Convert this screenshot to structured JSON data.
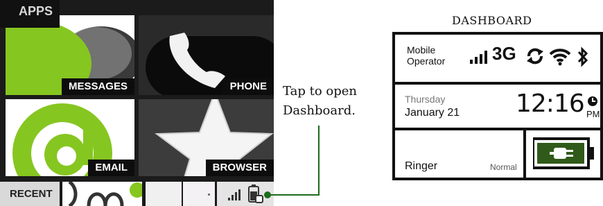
{
  "phone": {
    "apps_tab_label": "APPS",
    "tiles": [
      {
        "label": "MESSAGES",
        "icon": "messages-icon"
      },
      {
        "label": "PHONE",
        "icon": "phone-handset-icon"
      },
      {
        "label": "EMAIL",
        "icon": "at-sign-icon"
      },
      {
        "label": "BROWSER",
        "icon": "star-icon"
      }
    ],
    "bottom_bar": {
      "recent_label": "RECENT",
      "status_icons": [
        "signal-bars-icon",
        "battery-charging-icon"
      ]
    },
    "accent_color": "#88cc22"
  },
  "callout": {
    "text_line1": "Tap to open",
    "text_line2": "Dashboard.",
    "line_color": "#1d6b1d"
  },
  "dashboard": {
    "title": "DASHBOARD",
    "operator_line1": "Mobile",
    "operator_line2": "Operator",
    "network_type": "3G",
    "status_icons": [
      "signal-bars-icon",
      "sync-icon",
      "wifi-icon",
      "bluetooth-icon"
    ],
    "day": "Thursday",
    "date": "January 21",
    "time": "12:16",
    "ampm": "PM",
    "ringer_label": "Ringer",
    "ringer_value": "Normal",
    "battery_color": "#2f5a1a"
  }
}
